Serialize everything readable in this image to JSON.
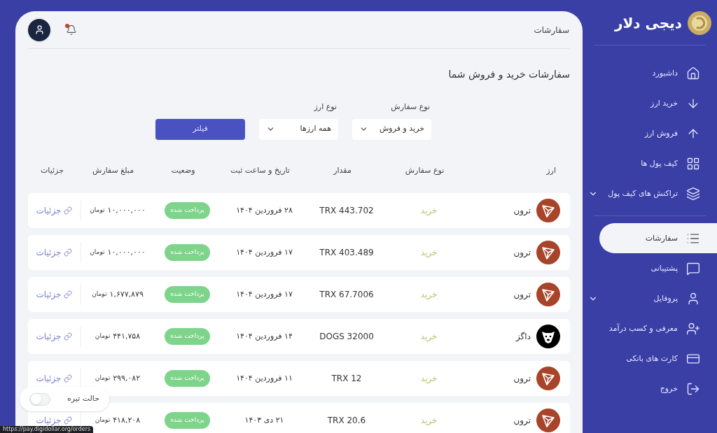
{
  "brand": {
    "name": "دیجی دلار"
  },
  "sidebar": {
    "items": [
      {
        "label": "داشبورد",
        "selected": false
      },
      {
        "label": "خرید ارز",
        "selected": false
      },
      {
        "label": "فروش ارز",
        "selected": false
      },
      {
        "label": "کیف پول ها",
        "selected": false
      },
      {
        "label": "تراکنش های کیف پول",
        "selected": false,
        "expandable": true
      },
      {
        "label": "سفارشات",
        "selected": true
      },
      {
        "label": "پشتیبانی",
        "selected": false
      },
      {
        "label": "پروفایل",
        "selected": false,
        "expandable": true
      },
      {
        "label": "معرفی و کسب درآمد",
        "selected": false
      },
      {
        "label": "کارت های بانکی",
        "selected": false
      },
      {
        "label": "خروج",
        "selected": false
      }
    ]
  },
  "header": {
    "breadcrumb": "سفارشات",
    "notification_dot": true
  },
  "page_title": "سفارشات خرید و فروش شما",
  "filters": [
    {
      "label": "نوع سفارش",
      "value": "خرید و فروش"
    },
    {
      "label": "نوع ارز",
      "value": "همه ارزها"
    }
  ],
  "filter_button": "فیلتر",
  "table": {
    "columns": [
      "ارز",
      "نوع سفارش",
      "مقدار",
      "تاریخ و ساعت ثبت",
      "وضعیت",
      "مبلغ سفارش",
      "جزئیات"
    ],
    "rows": [
      {
        "kind": "tron",
        "currency": "ترون",
        "type": "خرید",
        "amount": "TRX 443.702",
        "date": "۲۸ فروردین ۱۴۰۴",
        "status": "پرداخت شده",
        "price": "۱۰,۰۰۰,۰۰۰",
        "unit": "تومان",
        "details": "جزئیات"
      },
      {
        "kind": "tron",
        "currency": "ترون",
        "type": "خرید",
        "amount": "TRX 403.489",
        "date": "۱۷ فروردین ۱۴۰۴",
        "status": "پرداخت شده",
        "price": "۱۰,۰۰۰,۰۰۰",
        "unit": "تومان",
        "details": "جزئیات"
      },
      {
        "kind": "tron",
        "currency": "ترون",
        "type": "خرید",
        "amount": "TRX 67.7006",
        "date": "۱۷ فروردین ۱۴۰۴",
        "status": "پرداخت شده",
        "price": "۱,۶۷۷,۸۷۹",
        "unit": "تومان",
        "details": "جزئیات"
      },
      {
        "kind": "dogs",
        "currency": "داگز",
        "type": "خرید",
        "amount": "DOGS 32000",
        "date": "۱۴ فروردین ۱۴۰۴",
        "status": "پرداخت شده",
        "price": "۴۴۱,۷۵۸",
        "unit": "تومان",
        "details": "جزئیات"
      },
      {
        "kind": "tron",
        "currency": "ترون",
        "type": "خرید",
        "amount": "TRX 12",
        "date": "۱۱ فروردین ۱۴۰۴",
        "status": "پرداخت شده",
        "price": "۲۹۹,۰۸۲",
        "unit": "تومان",
        "details": "جزئیات"
      },
      {
        "kind": "tron",
        "currency": "ترون",
        "type": "خرید",
        "amount": "TRX 20.6",
        "date": "۲۱ دی ۱۴۰۳",
        "status": "پرداخت شده",
        "price": "۴۱۸,۲۰۸",
        "unit": "تومان",
        "details": "جزئیات"
      }
    ]
  },
  "dark_mode": {
    "label": "حالت تیره",
    "on": false
  },
  "status_url": "https://pay.digidollar.org/orders"
}
